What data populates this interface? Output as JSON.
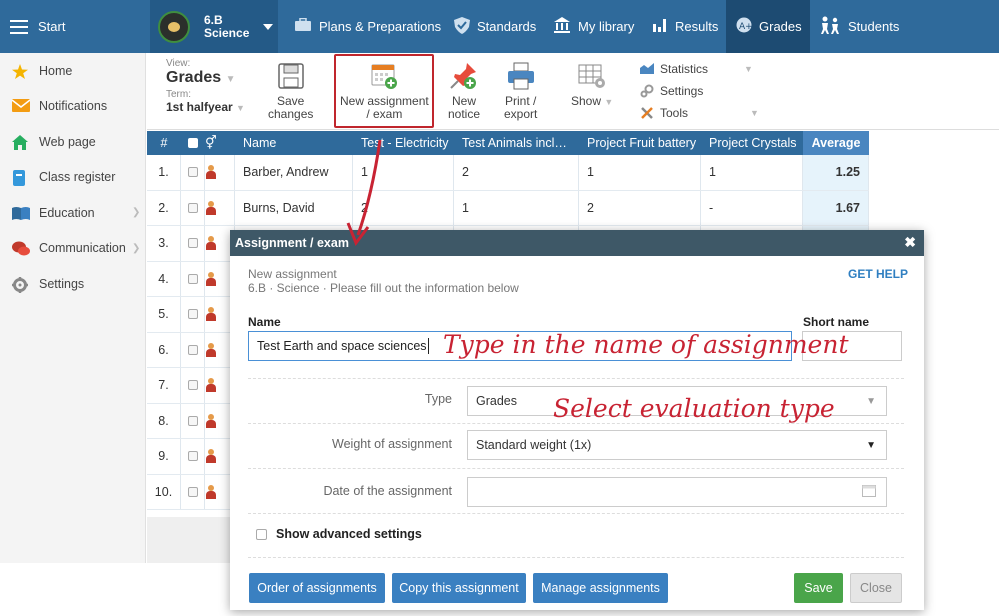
{
  "topbar": {
    "start_label": "Start",
    "class_line1": "6.B",
    "class_line2": "Science",
    "nav": [
      {
        "label": "Plans & Preparations"
      },
      {
        "label": "Standards"
      },
      {
        "label": "My library"
      },
      {
        "label": "Results"
      },
      {
        "label": "Grades"
      },
      {
        "label": "Students"
      }
    ]
  },
  "sidebar": {
    "items": [
      {
        "label": "Home"
      },
      {
        "label": "Notifications"
      },
      {
        "label": "Web page"
      },
      {
        "label": "Class register"
      },
      {
        "label": "Education"
      },
      {
        "label": "Communication"
      },
      {
        "label": "Settings"
      }
    ]
  },
  "toolbar": {
    "view_label": "View:",
    "view_value": "Grades",
    "term_label": "Term:",
    "term_value": "1st halfyear",
    "save_label_1": "Save",
    "save_label_2": "changes",
    "new_assignment_1": "New assignment",
    "new_assignment_2": "/ exam",
    "new_notice_1": "New",
    "new_notice_2": "notice",
    "print_1": "Print /",
    "print_2": "export",
    "show_label": "Show",
    "statistics": "Statistics",
    "settings": "Settings",
    "tools": "Tools"
  },
  "table": {
    "headers": [
      "#",
      "Name",
      "Test - Electricity",
      "Test Animals incl…",
      "Project Fruit battery",
      "Project Crystals",
      "Average"
    ],
    "rows": [
      {
        "num": "1.",
        "name": "Barber, Andrew",
        "g1": "1",
        "g2": "2",
        "g3": "1",
        "g4": "1",
        "avg": "1.25"
      },
      {
        "num": "2.",
        "name": "Burns, David",
        "g1": "2",
        "g2": "1",
        "g3": "2",
        "g4": "-",
        "avg": "1.67"
      },
      {
        "num": "3.",
        "name": "",
        "g1": "",
        "g2": "",
        "g3": "",
        "g4": "",
        "avg": ""
      },
      {
        "num": "4.",
        "name": "",
        "g1": "",
        "g2": "",
        "g3": "",
        "g4": "",
        "avg": ""
      },
      {
        "num": "5.",
        "name": "",
        "g1": "",
        "g2": "",
        "g3": "",
        "g4": "",
        "avg": ""
      },
      {
        "num": "6.",
        "name": "",
        "g1": "",
        "g2": "",
        "g3": "",
        "g4": "",
        "avg": ""
      },
      {
        "num": "7.",
        "name": "",
        "g1": "",
        "g2": "",
        "g3": "",
        "g4": "",
        "avg": ""
      },
      {
        "num": "8.",
        "name": "",
        "g1": "",
        "g2": "",
        "g3": "",
        "g4": "",
        "avg": ""
      },
      {
        "num": "9.",
        "name": "",
        "g1": "",
        "g2": "",
        "g3": "",
        "g4": "",
        "avg": ""
      },
      {
        "num": "10.",
        "name": "",
        "g1": "",
        "g2": "",
        "g3": "",
        "g4": "",
        "avg": ""
      }
    ]
  },
  "dialog": {
    "title": "Assignment / exam",
    "subtitle1": "New assignment",
    "subtitle2": "6.B · Science · Please fill out the information below",
    "get_help": "GET HELP",
    "name_label": "Name",
    "short_name_label": "Short name",
    "name_value": "Test Earth and space sciences",
    "type_label": "Type",
    "type_value": "Grades",
    "weight_label": "Weight of assignment",
    "weight_value": "Standard weight (1x)",
    "date_label": "Date of the assignment",
    "advanced_label": "Show advanced settings",
    "buttons": {
      "order": "Order of assignments",
      "copy": "Copy this assignment",
      "manage": "Manage assignments",
      "save": "Save",
      "close": "Close"
    }
  },
  "annotations": {
    "name_hint": "Type in the name of assignment",
    "type_hint": "Select evaluation type"
  },
  "colors": {
    "topbar": "#2f6a9b",
    "dialog_header": "#3e5867",
    "highlight": "#c0262d",
    "save_button": "#4aa54a",
    "blue_button": "#3a80c1"
  }
}
